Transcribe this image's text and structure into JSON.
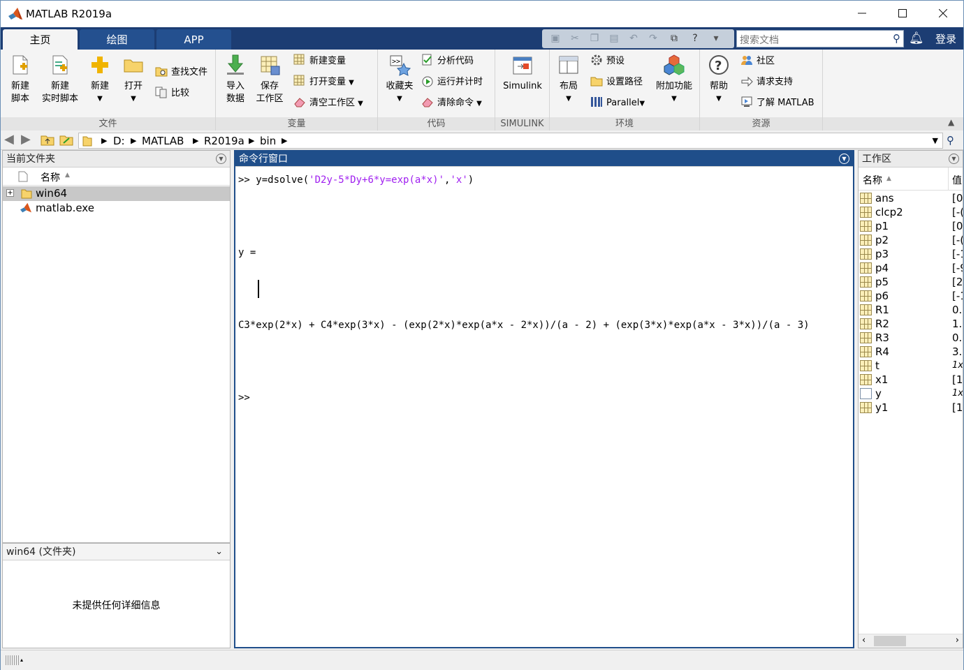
{
  "window": {
    "title": "MATLAB R2019a"
  },
  "tabs": [
    "主页",
    "绘图",
    "APP"
  ],
  "search": {
    "placeholder": "搜索文档"
  },
  "login_label": "登录",
  "ribbon": {
    "groups": {
      "file": "文件",
      "variable": "变量",
      "code": "代码",
      "simulink": "SIMULINK",
      "env": "环境",
      "resources": "资源"
    },
    "new_script": [
      "新建",
      "脚本"
    ],
    "new_live_script": [
      "新建",
      "实时脚本"
    ],
    "new": "新建",
    "open": "打开",
    "find_files": "查找文件",
    "compare": "比较",
    "import_data": [
      "导入",
      "数据"
    ],
    "save_workspace": [
      "保存",
      "工作区"
    ],
    "new_variable": "新建变量",
    "open_variable": "打开变量",
    "clear_workspace": "清空工作区",
    "favorites": "收藏夹",
    "analyze_code": "分析代码",
    "run_and_time": "运行并计时",
    "clear_commands": "清除命令",
    "simulink": "Simulink",
    "layout": "布局",
    "preferences": "预设",
    "set_path": "设置路径",
    "parallel": "Parallel",
    "add_ons": "附加功能",
    "help": "帮助",
    "community": "社区",
    "request_support": "请求支持",
    "learn_matlab": "了解 MATLAB"
  },
  "path": [
    "D:",
    "MATLAB",
    "R2019a",
    "bin"
  ],
  "current_folder": {
    "title": "当前文件夹",
    "column_name": "名称",
    "items": [
      {
        "name": "win64",
        "type": "folder"
      },
      {
        "name": "matlab.exe",
        "type": "file"
      }
    ],
    "detail_title": "win64  (文件夹)",
    "detail_text": "未提供任何详细信息"
  },
  "command_window": {
    "title": "命令行窗口",
    "prompt": ">>",
    "command_pre": "y=dsolve(",
    "command_str1": "'D2y-5*Dy+6*y=exp(a*x)'",
    "command_comma": ",",
    "command_str2": "'x'",
    "command_post": ")",
    "output_label": "y =",
    "output_expr": "C3*exp(2*x) + C4*exp(3*x) - (exp(2*x)*exp(a*x - 2*x))/(a - 2) + (exp(3*x)*exp(a*x - 3*x))/(a - 3)"
  },
  "workspace": {
    "title": "工作区",
    "column_name": "名称",
    "column_value": "值",
    "vars": [
      {
        "name": "ans",
        "value": "[0",
        "kind": "matrix"
      },
      {
        "name": "clcp2",
        "value": "[-(",
        "kind": "matrix"
      },
      {
        "name": "p1",
        "value": "[0",
        "kind": "matrix"
      },
      {
        "name": "p2",
        "value": "[-(",
        "kind": "matrix"
      },
      {
        "name": "p3",
        "value": "[-1",
        "kind": "matrix"
      },
      {
        "name": "p4",
        "value": "[-9",
        "kind": "matrix"
      },
      {
        "name": "p5",
        "value": "[2",
        "kind": "matrix"
      },
      {
        "name": "p6",
        "value": "[-1",
        "kind": "matrix"
      },
      {
        "name": "R1",
        "value": "0.",
        "kind": "matrix"
      },
      {
        "name": "R2",
        "value": "1.",
        "kind": "matrix"
      },
      {
        "name": "R3",
        "value": "0.",
        "kind": "matrix"
      },
      {
        "name": "R4",
        "value": "3.",
        "kind": "matrix"
      },
      {
        "name": "t",
        "value": "1x",
        "kind": "matrix"
      },
      {
        "name": "x1",
        "value": "[1",
        "kind": "matrix"
      },
      {
        "name": "y",
        "value": "1x",
        "kind": "symbolic"
      },
      {
        "name": "y1",
        "value": "[1",
        "kind": "matrix"
      }
    ]
  }
}
